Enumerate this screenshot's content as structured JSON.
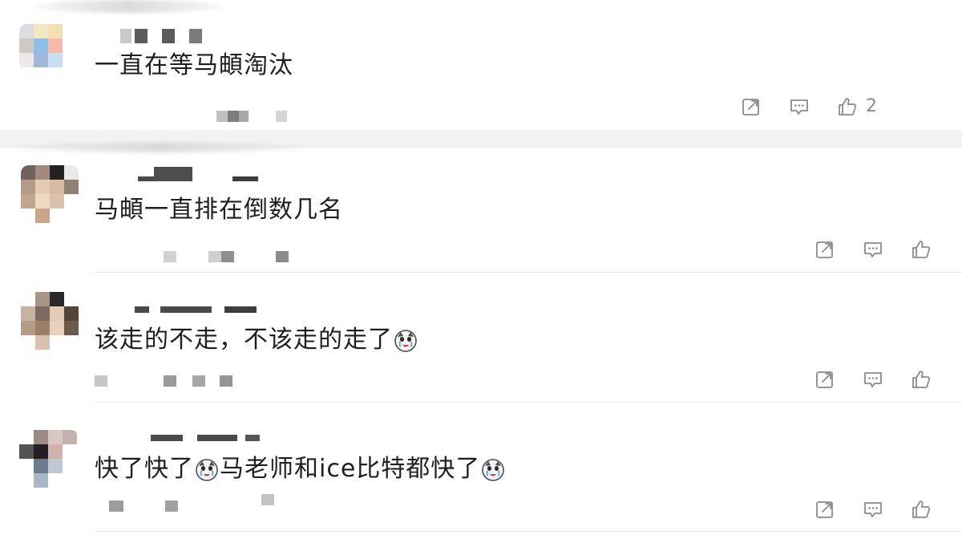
{
  "comments": [
    {
      "text": "一直在等马頔淘汰",
      "likes": "2"
    },
    {
      "text": "马頔一直排在倒数几名",
      "likes": ""
    },
    {
      "text_a": "该走的不走，不该走的走了",
      "likes": ""
    },
    {
      "text_a": "快了快了",
      "text_b": "马老师和ice比特都快了",
      "likes": ""
    }
  ],
  "icons": {
    "share": "share-icon",
    "reply": "comment-icon",
    "like": "thumbs-up-icon",
    "emoji": "crying-laughing-dog-emoji"
  },
  "colors": {
    "text": "#1f1f1f",
    "icon": "#8a8a8a",
    "divider": "#e8e8e8",
    "gap": "#f2f2f2"
  }
}
